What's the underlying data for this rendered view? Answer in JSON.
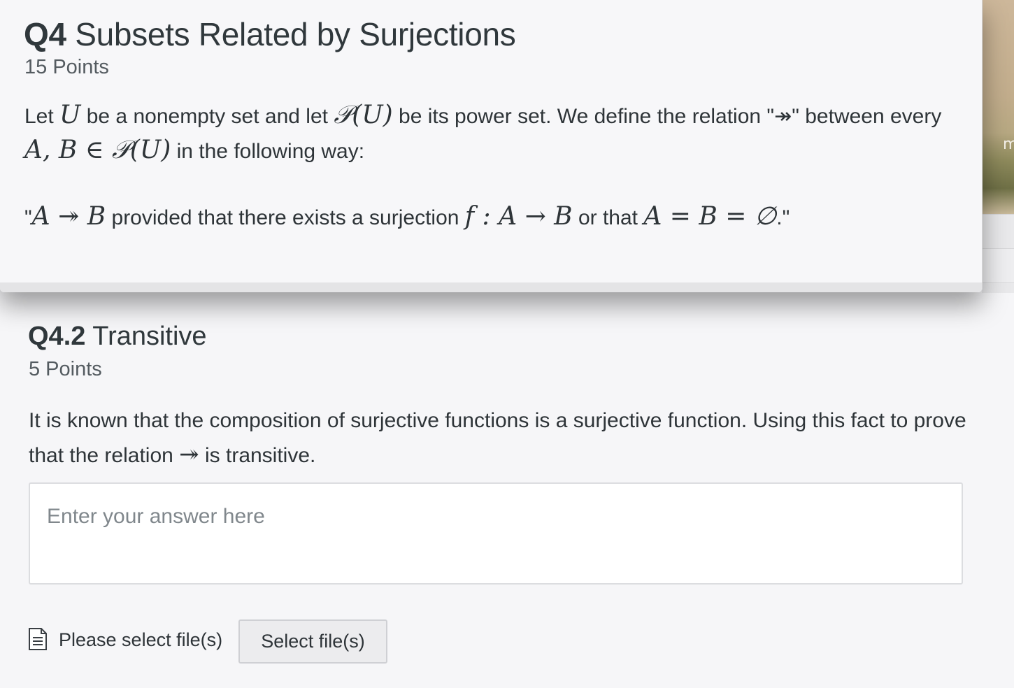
{
  "question": {
    "number": "Q4",
    "title": "Subsets Related by Surjections",
    "points": "15 Points",
    "body": {
      "p1": "Let ",
      "m_U": "U",
      "p2": " be a nonempty set and let ",
      "m_PU": "𝒫(U)",
      "p3": " be its power set. We define the relation \"↠\" between every ",
      "m_AB": "A, B ∈ 𝒫(U)",
      "p4": " in the following way:"
    },
    "statement": {
      "open": "\"",
      "m_rel": "A ↠ B",
      "s1": " provided that there exists a surjection ",
      "m_f": "f : A → B",
      "s2": " or that ",
      "m_eq": "A = B = ∅",
      "close": ".\""
    }
  },
  "subquestion": {
    "number": "Q4.2",
    "title": "Transitive",
    "points": "5 Points",
    "body_1": "It is known that the composition of surjective functions is a surjective function. Using this fact to prove that the relation ",
    "body_symbol": "↠",
    "body_2": " is transitive."
  },
  "answer": {
    "placeholder": "Enter your answer here"
  },
  "upload": {
    "icon": "file-icon",
    "label": "Please select file(s)",
    "button_label": "Select file(s)"
  },
  "background": {
    "partial_text": "m"
  }
}
